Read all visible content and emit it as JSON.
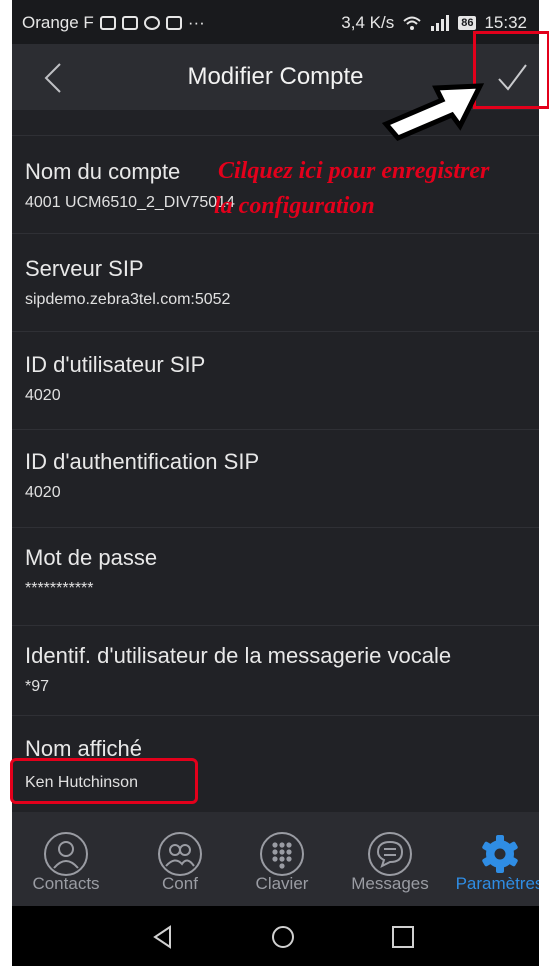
{
  "status_bar": {
    "carrier": "Orange F",
    "speed": "3,4 K/s",
    "battery": "86",
    "time": "15:32"
  },
  "header": {
    "title": "Modifier Compte",
    "back_icon": "chevron-left-icon",
    "save_icon": "checkmark-icon"
  },
  "fields": [
    {
      "label": "Nom du compte",
      "value": "4001 UCM6510_2_DIV75014"
    },
    {
      "label": "Serveur SIP",
      "value": "sipdemo.zebra3tel.com:5052"
    },
    {
      "label": "ID d'utilisateur SIP",
      "value": "4020"
    },
    {
      "label": "ID d'authentification SIP",
      "value": "4020"
    },
    {
      "label": "Mot de passe",
      "value": "***********"
    },
    {
      "label": "Identif. d'utilisateur de la messagerie vocale",
      "value": "*97"
    },
    {
      "label": "Nom affiché",
      "value": "Ken Hutchinson"
    }
  ],
  "annotation": {
    "line1": "Cilquez ici pour enregistrer",
    "line2": "la configuration",
    "color": "#e3001b"
  },
  "tabs": [
    {
      "label": "Contacts",
      "icon": "person-icon",
      "active": false
    },
    {
      "label": "Conf",
      "icon": "group-icon",
      "active": false
    },
    {
      "label": "Clavier",
      "icon": "dialpad-icon",
      "active": false
    },
    {
      "label": "Messages",
      "icon": "chat-icon",
      "active": false
    },
    {
      "label": "Paramètres",
      "icon": "gear-icon",
      "active": true
    }
  ],
  "colors": {
    "active_tab": "#2f8de4",
    "background": "#212226"
  }
}
